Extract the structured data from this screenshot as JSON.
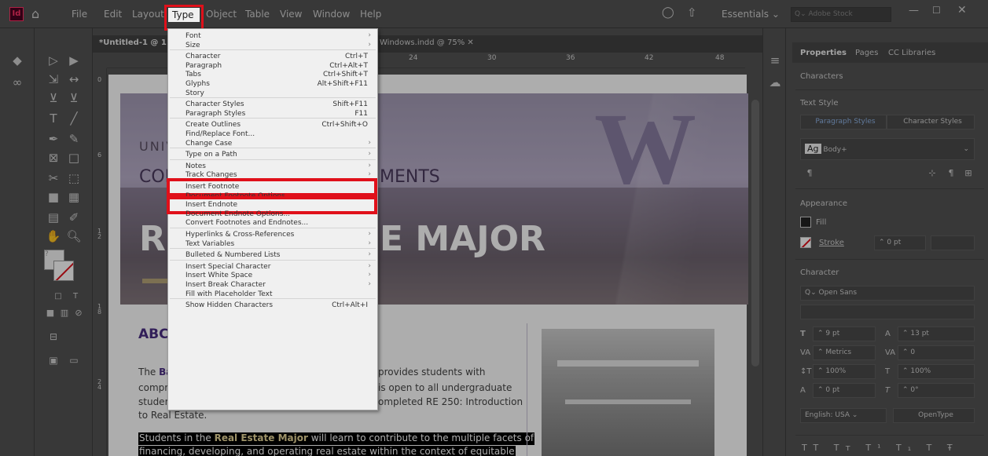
{
  "app": {
    "logo": "Id"
  },
  "menubar": {
    "items": [
      "File",
      "Edit",
      "Layout",
      "Type",
      "Object",
      "Table",
      "View",
      "Window",
      "Help"
    ],
    "workspace": "Essentials",
    "search_placeholder": "Adobe Stock"
  },
  "tabs": {
    "active": "*Untitled-1 @ 1",
    "second": "Windows.indd @ 75%"
  },
  "ruler": {
    "ticks": [
      "24",
      "30",
      "36",
      "42",
      "48"
    ],
    "left_ticks": [
      "0",
      "6",
      "1 2",
      "1 8",
      "2 4"
    ]
  },
  "document": {
    "hero_univ": "UNIV",
    "hero_col": "COL",
    "hero_ments": "MENTS",
    "hero_major": "E MAJOR",
    "hero_r": "R",
    "hero_w": "W",
    "heading": "ABC",
    "body_line1_a": "The ",
    "body_line1_b": "Ba",
    "body_line1_c": "provides students with",
    "body_line2_a": "compr",
    "body_line2_b": "is open to all undergraduate",
    "body_line3_a": "studer",
    "body_line3_b": "ompleted RE 250: Introduction",
    "body_line4": "to Real Estate.",
    "highlight_line1_a": "Students in the ",
    "highlight_line1_b": "Real Estate Major",
    "highlight_line1_c": " will learn to contribute to the multiple facets of",
    "highlight_line2": "financing, developing, and operating real estate within the context of equitable"
  },
  "type_menu": {
    "items": [
      {
        "label": "Font",
        "shortcut": "",
        "submenu": true
      },
      {
        "label": "Size",
        "shortcut": "",
        "submenu": true
      },
      {
        "sep": true
      },
      {
        "label": "Character",
        "shortcut": "Ctrl+T",
        "submenu": false
      },
      {
        "label": "Paragraph",
        "shortcut": "Ctrl+Alt+T",
        "submenu": false
      },
      {
        "label": "Tabs",
        "shortcut": "Ctrl+Shift+T",
        "submenu": false
      },
      {
        "label": "Glyphs",
        "shortcut": "Alt+Shift+F11",
        "submenu": false
      },
      {
        "label": "Story",
        "shortcut": "",
        "submenu": false
      },
      {
        "sep": true
      },
      {
        "label": "Character Styles",
        "shortcut": "Shift+F11",
        "submenu": false
      },
      {
        "label": "Paragraph Styles",
        "shortcut": "F11",
        "submenu": false
      },
      {
        "sep": true
      },
      {
        "label": "Create Outlines",
        "shortcut": "Ctrl+Shift+O",
        "submenu": false
      },
      {
        "label": "Find/Replace Font...",
        "shortcut": "",
        "submenu": false
      },
      {
        "label": "Change Case",
        "shortcut": "",
        "submenu": true
      },
      {
        "sep": true
      },
      {
        "label": "Type on a Path",
        "shortcut": "",
        "submenu": true
      },
      {
        "sep": true
      },
      {
        "label": "Notes",
        "shortcut": "",
        "submenu": true
      },
      {
        "label": "Track Changes",
        "shortcut": "",
        "submenu": true
      },
      {
        "sep": true
      },
      {
        "label": "Insert Footnote",
        "shortcut": "",
        "submenu": false,
        "highlight": true
      },
      {
        "label": "Document Footnote Options...",
        "shortcut": "",
        "submenu": false
      },
      {
        "label": "Insert Endnote",
        "shortcut": "",
        "submenu": false,
        "highlight": true
      },
      {
        "label": "Document Endnote Options...",
        "shortcut": "",
        "submenu": false
      },
      {
        "label": "Convert Footnotes and Endnotes...",
        "shortcut": "",
        "submenu": false
      },
      {
        "sep": true
      },
      {
        "label": "Hyperlinks & Cross-References",
        "shortcut": "",
        "submenu": true
      },
      {
        "label": "Text Variables",
        "shortcut": "",
        "submenu": true
      },
      {
        "sep": true
      },
      {
        "label": "Bulleted & Numbered Lists",
        "shortcut": "",
        "submenu": true
      },
      {
        "sep": true
      },
      {
        "label": "Insert Special Character",
        "shortcut": "",
        "submenu": true
      },
      {
        "label": "Insert White Space",
        "shortcut": "",
        "submenu": true
      },
      {
        "label": "Insert Break Character",
        "shortcut": "",
        "submenu": true
      },
      {
        "label": "Fill with Placeholder Text",
        "shortcut": "",
        "submenu": false
      },
      {
        "sep": true
      },
      {
        "label": "Show Hidden Characters",
        "shortcut": "Ctrl+Alt+I",
        "submenu": false
      }
    ]
  },
  "properties": {
    "tabs": [
      "Properties",
      "Pages",
      "CC Libraries"
    ],
    "characters": "Characters",
    "text_style": "Text Style",
    "style_tabs": [
      "Paragraph Styles",
      "Character Styles"
    ],
    "style_value": "Body+",
    "style_ag": "Ag",
    "appearance": "Appearance",
    "fill": "Fill",
    "stroke": "Stroke",
    "stroke_value": "0 pt",
    "character": "Character",
    "font": "Open Sans",
    "size": "9 pt",
    "leading": "13 pt",
    "kerning": "Metrics",
    "tracking": "0",
    "vscale": "100%",
    "hscale": "100%",
    "baseline": "0 pt",
    "skew": "0°",
    "language": "English: USA",
    "opentype": "OpenType"
  },
  "colors": {
    "highlight_red": "#e0101a",
    "accent_purple": "#4b2e83",
    "gold": "#b7a57a"
  }
}
